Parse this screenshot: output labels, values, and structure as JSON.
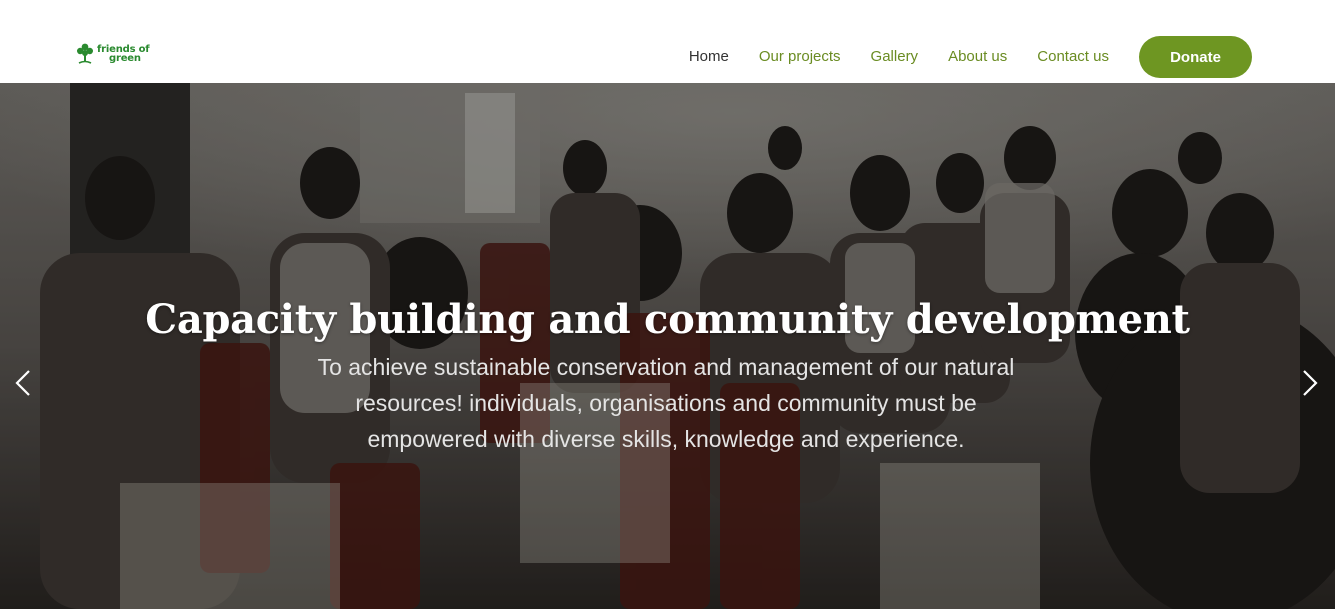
{
  "brand": {
    "line1": "friends of",
    "line2": "green"
  },
  "nav": {
    "home": "Home",
    "projects": "Our projects",
    "gallery": "Gallery",
    "about": "About us",
    "contact": "Contact us",
    "donate": "Donate"
  },
  "hero": {
    "title": "Capacity building and community development",
    "subtitle": "To achieve sustainable conservation and management of our natural resources! individuals, organisations and community must be empowered with diverse skills, knowledge and experience."
  },
  "colors": {
    "accent": "#6e9622",
    "nav_link": "#6a8c22",
    "logo": "#2a8a2f"
  },
  "icons": {
    "prev": "chevron-left-icon",
    "next": "chevron-right-icon",
    "logo": "tree-icon"
  }
}
